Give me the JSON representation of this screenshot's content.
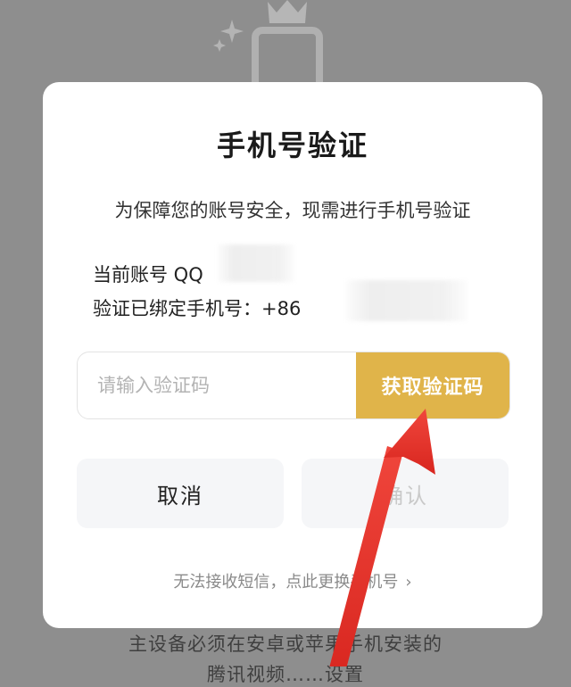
{
  "dialog": {
    "title": "手机号验证",
    "subtitle": "为保障您的账号安全，现需进行手机号验证",
    "account_label": "当前账号 QQ",
    "phone_label": "验证已绑定手机号：+86",
    "code_input": {
      "value": "",
      "placeholder": "请输入验证码"
    },
    "get_code_label": "获取验证码",
    "cancel_label": "取消",
    "confirm_label": "确认",
    "change_phone_label": "无法接收短信，点此更换手机号"
  },
  "background": {
    "footer_line1": "主设备必须在安卓或苹果手机安装的",
    "footer_line2": "腾讯视频……设置"
  },
  "icons": {
    "chevron": "chevron-right-icon",
    "sparkle": "sparkle-icon",
    "crown": "crown-icon"
  },
  "colors": {
    "accent": "#e0b44a",
    "overlay": "#8e8e8e",
    "arrow": "#e8322b"
  }
}
